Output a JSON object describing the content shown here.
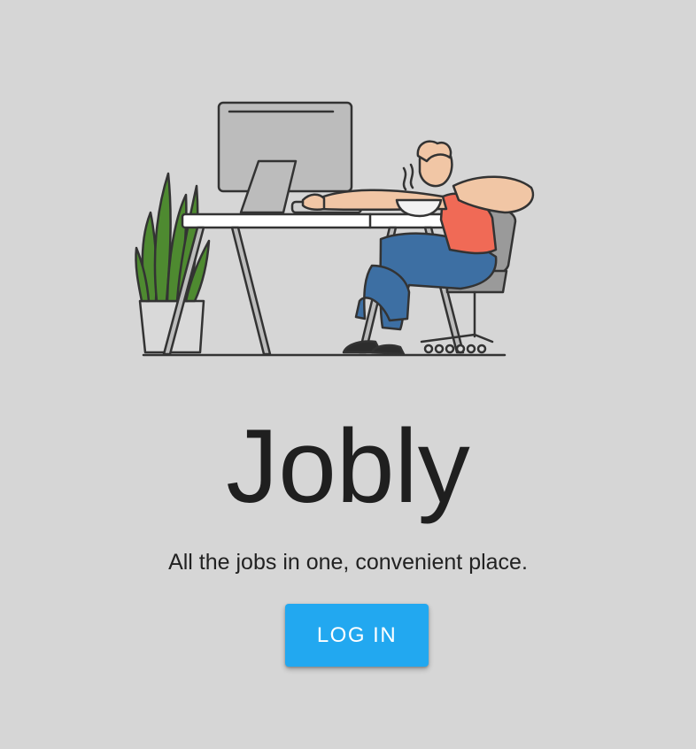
{
  "app": {
    "title": "Jobly",
    "tagline": "All the jobs in one, convenient place."
  },
  "actions": {
    "login_label": "LOG IN"
  },
  "illustration": {
    "name": "person-working-at-desk-illustration"
  },
  "colors": {
    "background": "#d6d6d6",
    "accent": "#22a8f0",
    "title_text": "#1f1f1f"
  }
}
